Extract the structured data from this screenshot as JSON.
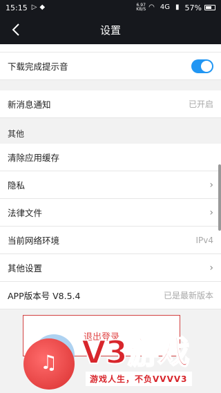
{
  "status_bar": {
    "time": "15:15",
    "net_speed_value": "6.97",
    "net_speed_unit": "KB/S",
    "signal_label": "4G",
    "battery": "57%"
  },
  "header": {
    "title": "设置"
  },
  "rows": {
    "download_sound": {
      "label": "下载完成提示音",
      "toggle_on": true
    },
    "new_message": {
      "label": "新消息通知",
      "value": "已开启"
    },
    "other_header": "其他",
    "clear_cache": {
      "label": "清除应用缓存"
    },
    "privacy": {
      "label": "隐私"
    },
    "legal": {
      "label": "法律文件"
    },
    "network": {
      "label": "当前网络环境",
      "value": "IPv4"
    },
    "other_settings": {
      "label": "其他设置"
    },
    "app_version": {
      "label": "APP版本号 V8.5.4",
      "value": "已是最新版本"
    }
  },
  "logout": {
    "label": "退出登录"
  },
  "watermark": {
    "brand": "V3游戏",
    "slogan": "游戏人生，不负VVVV3"
  },
  "colors": {
    "header_bg": "#16181d",
    "toggle_on": "#2196f3",
    "logout_red": "#e04848",
    "watermark_red": "#d8262c"
  }
}
